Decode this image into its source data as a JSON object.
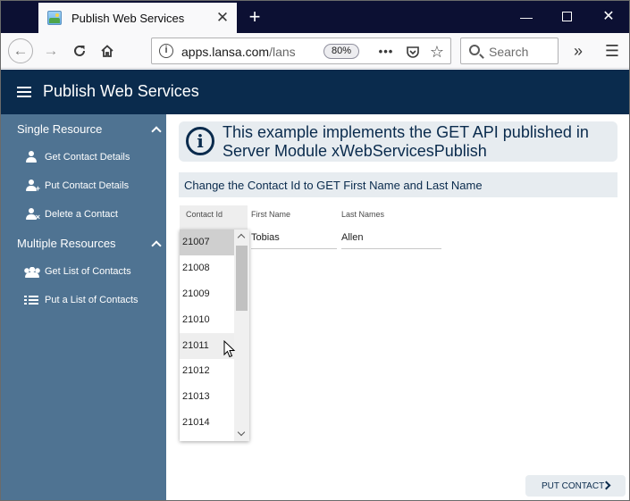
{
  "browser": {
    "tab_title": "Publish Web Services",
    "url_host": "apps.lansa.com",
    "url_path": "/lans",
    "zoom": "80%",
    "search_placeholder": "Search",
    "icons": [
      "back-icon",
      "forward-icon",
      "reload-icon",
      "home-icon",
      "info-icon",
      "more-icon",
      "pocket-icon",
      "star-icon",
      "search-icon",
      "overflow-icon",
      "menu-icon"
    ]
  },
  "header": {
    "title": "Publish Web Services"
  },
  "sidebar": {
    "sections": [
      {
        "label": "Single Resource",
        "items": [
          {
            "label": "Get Contact Details",
            "icon": "user-icon"
          },
          {
            "label": "Put Contact Details",
            "icon": "user-plus-icon"
          },
          {
            "label": "Delete a Contact",
            "icon": "user-delete-icon"
          }
        ]
      },
      {
        "label": "Multiple Resources",
        "items": [
          {
            "label": "Get List of Contacts",
            "icon": "users-icon"
          },
          {
            "label": "Put a List of Contacts",
            "icon": "list-icon"
          }
        ]
      }
    ]
  },
  "main": {
    "info_text": "This example implements the GET API published in Server Module xWebServicesPublish",
    "section_title": "Change the Contact Id to GET First Name and Last Name",
    "fields": {
      "contact_id_label": "Contact Id",
      "first_name_label": "First Name",
      "first_name_value": "Tobias",
      "last_names_label": "Last Names",
      "last_names_value": "Allen"
    },
    "dropdown_options": [
      "21007",
      "21008",
      "21009",
      "21010",
      "21011",
      "21012",
      "21013",
      "21014"
    ],
    "selected_option": "21007",
    "hover_option": "21011",
    "put_button_label": "PUT CONTACT"
  },
  "colors": {
    "header_bg": "#0a2b4d",
    "sidebar_bg": "#4f7392",
    "banner_bg": "#e7ecf0",
    "titlebar_bg": "#0c1033"
  }
}
